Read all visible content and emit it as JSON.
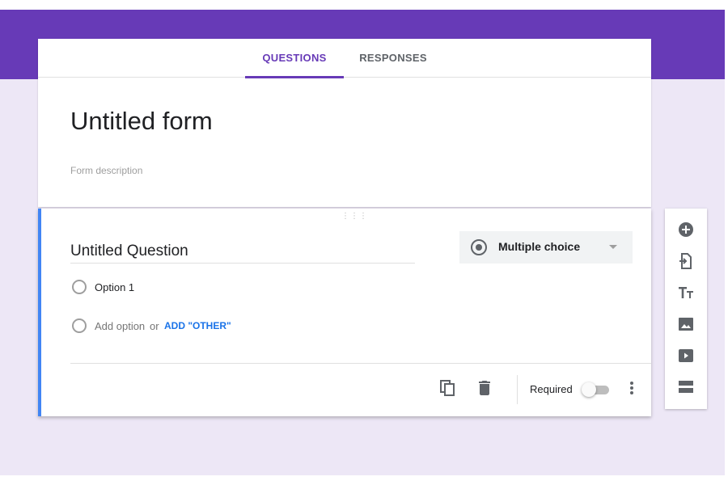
{
  "tabs": [
    {
      "label": "QUESTIONS",
      "active": true
    },
    {
      "label": "RESPONSES",
      "active": false
    }
  ],
  "form": {
    "title": "Untitled form",
    "description_placeholder": "Form description"
  },
  "question": {
    "title": "Untitled Question",
    "type": "Multiple choice",
    "options": [
      "Option 1"
    ],
    "add_option_label": "Add option",
    "or_label": "or",
    "add_other_label": "ADD \"OTHER\"",
    "required_label": "Required",
    "required": false
  },
  "toolbar": {
    "tools": [
      "add-question-icon",
      "import-questions-icon",
      "add-title-icon",
      "add-image-icon",
      "add-video-icon",
      "add-section-icon"
    ]
  },
  "colors": {
    "theme": "#673ab7",
    "background": "#ede7f6",
    "active_question_border": "#4285f4",
    "link": "#1a73e8"
  }
}
